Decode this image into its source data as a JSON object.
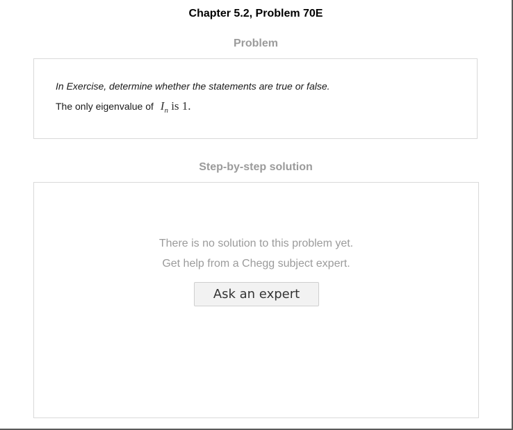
{
  "header": {
    "title": "Chapter 5.2, Problem 70E"
  },
  "problem": {
    "heading": "Problem",
    "instruction": "In Exercise, determine whether the statements are true or false.",
    "statement_prefix": "The only eigenvalue of",
    "math_var": "I",
    "math_sub": "n",
    "math_suffix": " is 1."
  },
  "solution": {
    "heading": "Step-by-step solution",
    "message_line1": "There is no solution to this problem yet.",
    "message_line2": "Get help from a Chegg subject expert.",
    "ask_button_label": "Ask an expert"
  }
}
